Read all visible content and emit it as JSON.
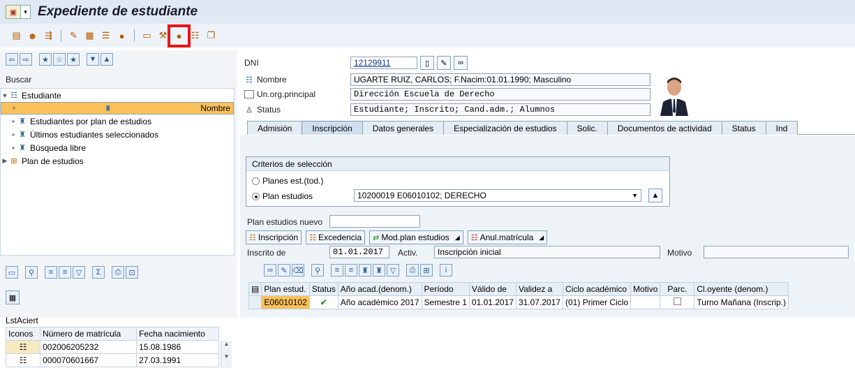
{
  "window": {
    "title": "Expediente de estudiante"
  },
  "toolbar": {
    "icons": [
      "form-icon",
      "person-search-icon",
      "flow-icon",
      "edit-arrow-icon",
      "chart-icon",
      "list-icon",
      "coin-icon",
      "folder-open-icon",
      "wand-icon",
      "highlighted-coin-icon",
      "people-icon",
      "copy-icon"
    ]
  },
  "left": {
    "search_label": "Buscar",
    "tree": [
      {
        "label": "Estudiante",
        "level": 0,
        "expanded": true
      },
      {
        "label": "Nombre",
        "level": 1,
        "selected": true
      },
      {
        "label": "Estudiantes por plan de estudios",
        "level": 1
      },
      {
        "label": "Últimos estudiantes seleccionados",
        "level": 1
      },
      {
        "label": "Búsqueda libre",
        "level": 1
      },
      {
        "label": "Plan de estudios",
        "level": 0,
        "expanded": false
      }
    ],
    "list_title": "LstAciert",
    "list_columns": [
      "Iconos",
      "Número de matrícula",
      "Fecha nacimiento"
    ],
    "list_rows": [
      {
        "matricula": "002006205232",
        "fecha": "15.08.1986"
      },
      {
        "matricula": "000070601667",
        "fecha": "27.03.1991"
      }
    ]
  },
  "header": {
    "dni_label": "DNI",
    "dni_value": "12129911",
    "nombre_label": "Nombre",
    "nombre_value": "UGARTE RUIZ, CARLOS; F.Nacim:01.01.1990; Masculino",
    "unorg_label": "Un.org.principal",
    "unorg_value": "Dirección Escuela de Derecho",
    "status_label": "Status",
    "status_value": "Estudiante; Inscrito; Cand.adm.; Alumnos"
  },
  "tabs": [
    "Admisión",
    "Inscripción",
    "Datos generales",
    "Especialización de estudios",
    "Solic.",
    "Documentos de actividad",
    "Status",
    "Ind"
  ],
  "active_tab": "Inscripción",
  "criteria": {
    "title": "Criterios de selección",
    "option1": "Planes est.(tod.)",
    "option2": "Plan estudios",
    "plan_value": "10200019 E06010102; DERECHO"
  },
  "form": {
    "nuevo_label": "Plan estudios nuevo",
    "btn_inscripcion": "Inscripción",
    "btn_excedencia": "Excedencia",
    "btn_mod": "Mod.plan estudios",
    "btn_anul": "Anul.matrícula",
    "inscrito_label": "Inscrito de",
    "inscrito_value": "01.01.2017",
    "activ_label": "Activ.",
    "activ_value": "Inscripción inicial",
    "motivo_label": "Motivo"
  },
  "grid": {
    "columns": [
      "Plan estud.",
      "Status",
      "Año acad.(denom.)",
      "Período",
      "Válido de",
      "Validez a",
      "Ciclo académico",
      "Motivo",
      "Parc.",
      "Cl.oyente (denom.)"
    ],
    "rows": [
      {
        "plan": "E06010102",
        "status": "✔",
        "anio": "Año académico 2017",
        "periodo": "Semestre 1",
        "valido_de": "01.01.2017",
        "validez_a": "31.07.2017",
        "ciclo": "(01) Primer Ciclo",
        "motivo": "",
        "oyente": "Turno Mañana (Inscrip.)"
      }
    ]
  },
  "colors": {
    "selection": "#fbc15b",
    "highlight_box": "#e8141a",
    "panel": "#eef3f8"
  }
}
